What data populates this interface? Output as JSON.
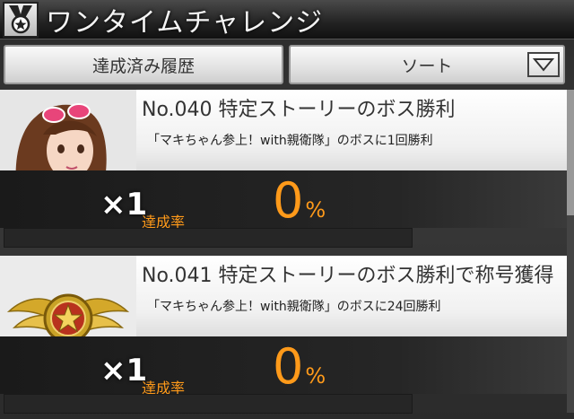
{
  "header": {
    "title": "ワンタイムチャレンジ",
    "icon": "medal-icon"
  },
  "toolbar": {
    "history_label": "達成済み履歴",
    "sort_label": "ソート"
  },
  "challenges": [
    {
      "title": "No.040 特定ストーリーのボス勝利",
      "description": "「マキちゃん参上！with親衛隊」のボスに1回勝利",
      "multiplier": "×1",
      "rate_label": "達成率",
      "rate_value": "0",
      "rate_unit": "%",
      "progress": 0,
      "reward_icon": "character-portrait-icon"
    },
    {
      "title": "No.041 特定ストーリーのボス勝利で称号獲得",
      "description": "「マキちゃん参上！with親衛隊」のボスに24回勝利",
      "multiplier": "×1",
      "rate_label": "達成率",
      "rate_value": "0",
      "rate_unit": "%",
      "progress": 0,
      "reward_icon": "gold-emblem-icon"
    }
  ],
  "colors": {
    "accent": "#ff9a1a"
  }
}
